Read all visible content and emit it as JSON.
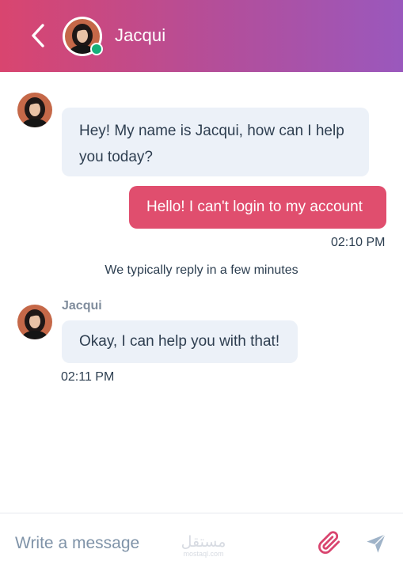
{
  "header": {
    "contact_name": "Jacqui",
    "status": "online"
  },
  "messages": [
    {
      "sender": "agent",
      "text": "Hey! My name is Jacqui, how can I help you today?"
    },
    {
      "sender": "user",
      "text": "Hello! I can't login to my account",
      "time": "02:10 PM"
    },
    {
      "sender": "agent",
      "name": "Jacqui",
      "text": "Okay, I can help you with that!",
      "time": "02:11 PM"
    }
  ],
  "reply_note": "We typically reply in a few minutes",
  "composer": {
    "placeholder": "Write a message",
    "watermark_arabic": "مستقل",
    "watermark_url": "mostaql.com"
  },
  "icons": {
    "back": "chevron-left-icon",
    "attach": "paperclip-icon",
    "send": "send-icon"
  },
  "colors": {
    "header_gradient_start": "#d9456f",
    "header_gradient_end": "#9a58bd",
    "incoming_bubble": "#ecf1f8",
    "outgoing_bubble": "#e04e6e",
    "online": "#15b07a",
    "attach_icon": "#d9456f",
    "send_icon": "#9fb3c8"
  }
}
